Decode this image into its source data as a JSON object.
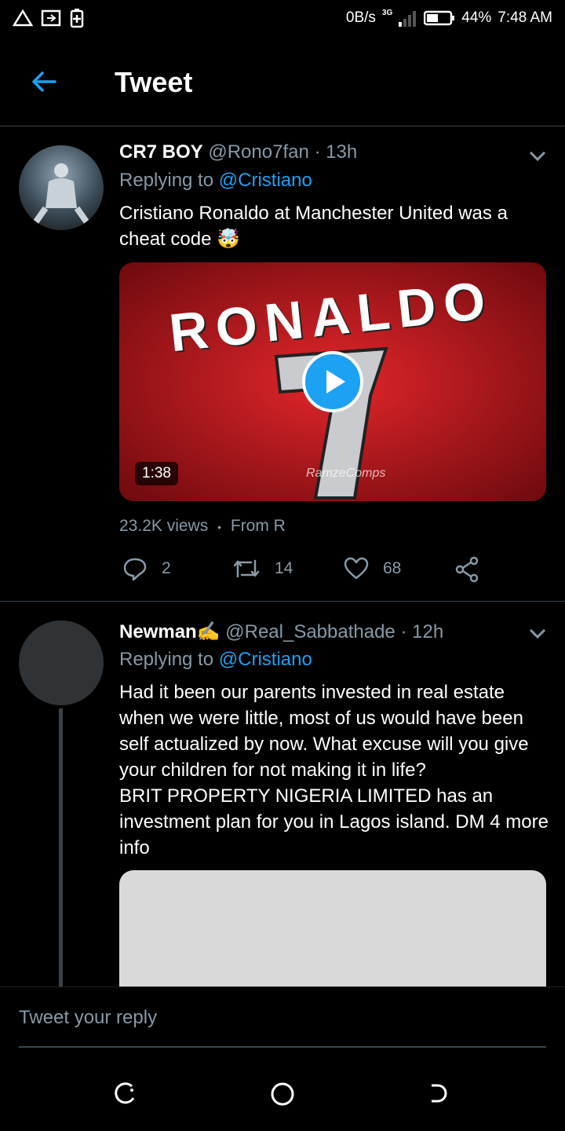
{
  "status": {
    "speed": "0B/s",
    "network": "3G",
    "battery": "44%",
    "time": "7:48 AM"
  },
  "header": {
    "title": "Tweet"
  },
  "tweet1": {
    "name": "CR7 BOY",
    "handle": "@Rono7fan",
    "sep": "·",
    "time": "13h",
    "replying_prefix": "Replying to",
    "replying_to": "@Cristiano",
    "text": "Cristiano Ronaldo at Manchester United was a cheat code 🤯",
    "video_duration": "1:38",
    "video_watermark": "RamzeComps",
    "video_jersey_text": "RONALDO",
    "video_jersey_number": "7",
    "views": "23.2K views",
    "dot": "•",
    "from": "From R",
    "replies": "2",
    "retweets": "14",
    "likes": "68"
  },
  "tweet2": {
    "name": "Newman✍️",
    "handle": "@Real_Sabbathade",
    "sep": "·",
    "time": "12h",
    "replying_prefix": "Replying to",
    "replying_to": "@Cristiano",
    "text": "Had it been our parents invested in real estate when we were little, most of us would have been self actualized by now. What excuse will you give your children for not making it in life?\nBRIT PROPERTY NIGERIA LIMITED has an investment plan for you in Lagos island. DM 4 more info"
  },
  "reply": {
    "placeholder": "Tweet your reply"
  },
  "colors": {
    "accent": "#1da1f2",
    "muted": "#8899a6",
    "divider": "#38444d",
    "jersey": "#d11a1f"
  }
}
